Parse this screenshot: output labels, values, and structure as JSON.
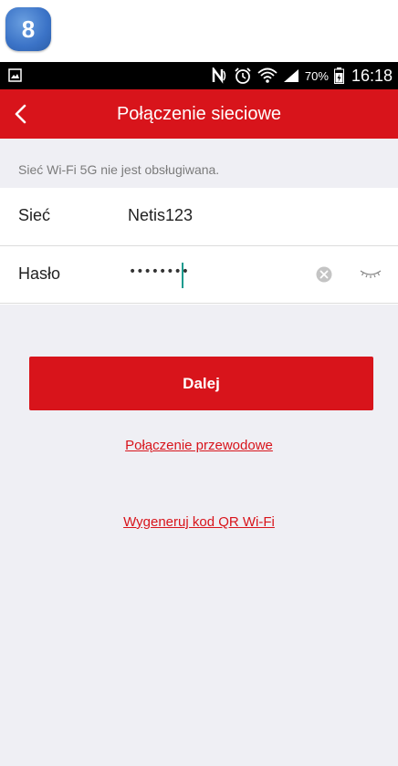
{
  "step": {
    "number": "8"
  },
  "status_bar": {
    "battery_percent": "70%",
    "time": "16:18",
    "icons": [
      "image-icon",
      "nfc-icon",
      "alarm-icon",
      "wifi-icon",
      "signal-icon",
      "battery-icon"
    ]
  },
  "app_bar": {
    "title": "Połączenie sieciowe",
    "back_icon": "chevron-left-icon"
  },
  "notice": "Sieć Wi-Fi 5G nie jest obsługiwana.",
  "form": {
    "network": {
      "label": "Sieć",
      "value": "Netis123"
    },
    "password": {
      "label": "Hasło",
      "masked_value": "••••••••",
      "clear_icon": "clear-icon",
      "toggle_icon": "eye-closed-icon"
    }
  },
  "actions": {
    "next_label": "Dalej",
    "wired_link": "Połączenie przewodowe",
    "qr_link": "Wygeneruj kod QR Wi-Fi"
  },
  "colors": {
    "brand_red": "#d8141b",
    "background": "#efeff4",
    "caret": "#1a9b8f",
    "step_badge": "#3b73c7"
  }
}
